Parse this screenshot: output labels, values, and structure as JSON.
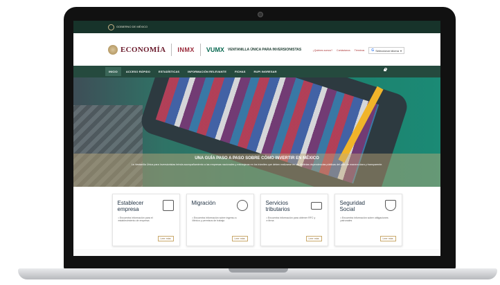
{
  "gov_bar": {
    "label": "GOBIERNO DE MÉXICO"
  },
  "header": {
    "org": "ECONOMÍA",
    "inmx": "INMX",
    "vumx": "VUMX",
    "tagline": "VENTANILLA ÚNICA PARA INVERSIONISTAS",
    "links": [
      "¿Quiénes somos?",
      "Contáctanos",
      "Términos"
    ],
    "translate_label": "Seleccionar idioma"
  },
  "nav": {
    "items": [
      "INICIO",
      "ACCESO RÁPIDO",
      "ESTADÍSTICAS",
      "INFORMACIÓN RELEVANTE",
      "FICHAS",
      "RUPI INGRESAR"
    ]
  },
  "hero": {
    "title": "UNA GUÍA PASO A PASO SOBRE CÓMO INVERTIR EN MÉXICO",
    "description": "La Ventanilla Única para Inversionistas brinda acompañamiento a las empresas nacionales y extranjeras en los trámites que deben realizarse en las distintas dependencias públicas del país de manera clara y transparente."
  },
  "cards": [
    {
      "title": "Establecer empresa",
      "desc": "• Encuentra información para el establecimiento de empresa",
      "btn": "Leer más",
      "icon": "building-icon"
    },
    {
      "title": "Migración",
      "desc": "• Encuentra información sobre ingreso a México y permisos de trabajo",
      "btn": "Leer más",
      "icon": "globe-plane-icon"
    },
    {
      "title": "Servicios tributarios",
      "desc": "• Encuentra información para obtener RFC y e.firma",
      "btn": "Leer más",
      "icon": "money-icon"
    },
    {
      "title": "Seguridad Social",
      "desc": "• Encuentra información sobre obligaciones patronales",
      "btn": "Leer más",
      "icon": "shield-icon"
    }
  ],
  "colors": {
    "gov_green": "#17332a",
    "nav_green": "#254a3e",
    "wine": "#6b1b2c",
    "gold": "#c9a86a"
  }
}
